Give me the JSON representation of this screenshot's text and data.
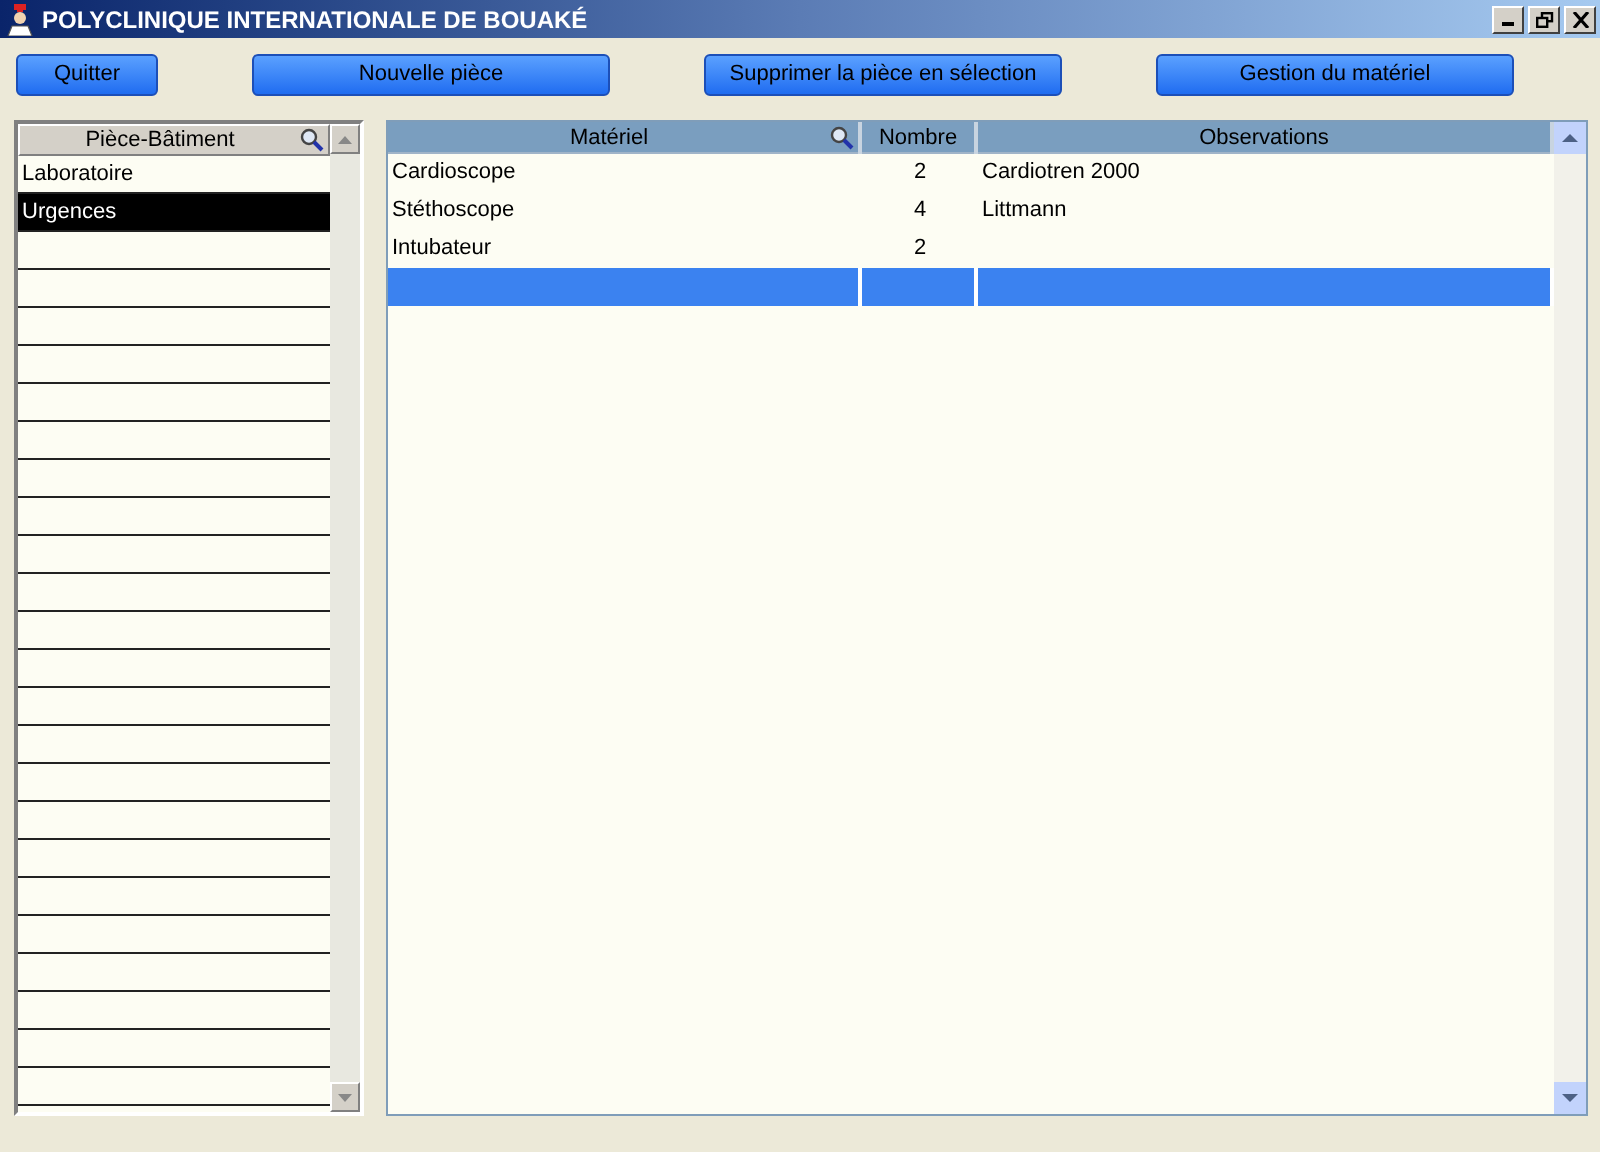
{
  "window": {
    "title": "POLYCLINIQUE INTERNATIONALE DE BOUAKÉ"
  },
  "buttons": [
    {
      "label": "Quitter"
    },
    {
      "label": "Nouvelle pièce"
    },
    {
      "label": "Supprimer la pièce en sélection"
    },
    {
      "label": "Gestion du matériel"
    }
  ],
  "rooms": {
    "column": "Pièce-Bâtiment",
    "items": [
      {
        "label": "Laboratoire",
        "selected": false
      },
      {
        "label": "Urgences",
        "selected": true
      }
    ]
  },
  "table": {
    "columns": [
      "Matériel",
      "Nombre",
      "Observations"
    ],
    "rows": [
      {
        "kind": "data",
        "selected": false,
        "cells": [
          "Cardioscope",
          "2",
          "Cardiotren 2000"
        ]
      },
      {
        "kind": "data",
        "selected": false,
        "cells": [
          "Stéthoscope",
          "4",
          "Littmann"
        ]
      },
      {
        "kind": "data",
        "selected": false,
        "cells": [
          "Intubateur",
          "2"
        ]
      },
      {
        "kind": "new",
        "selected": true
      }
    ]
  }
}
